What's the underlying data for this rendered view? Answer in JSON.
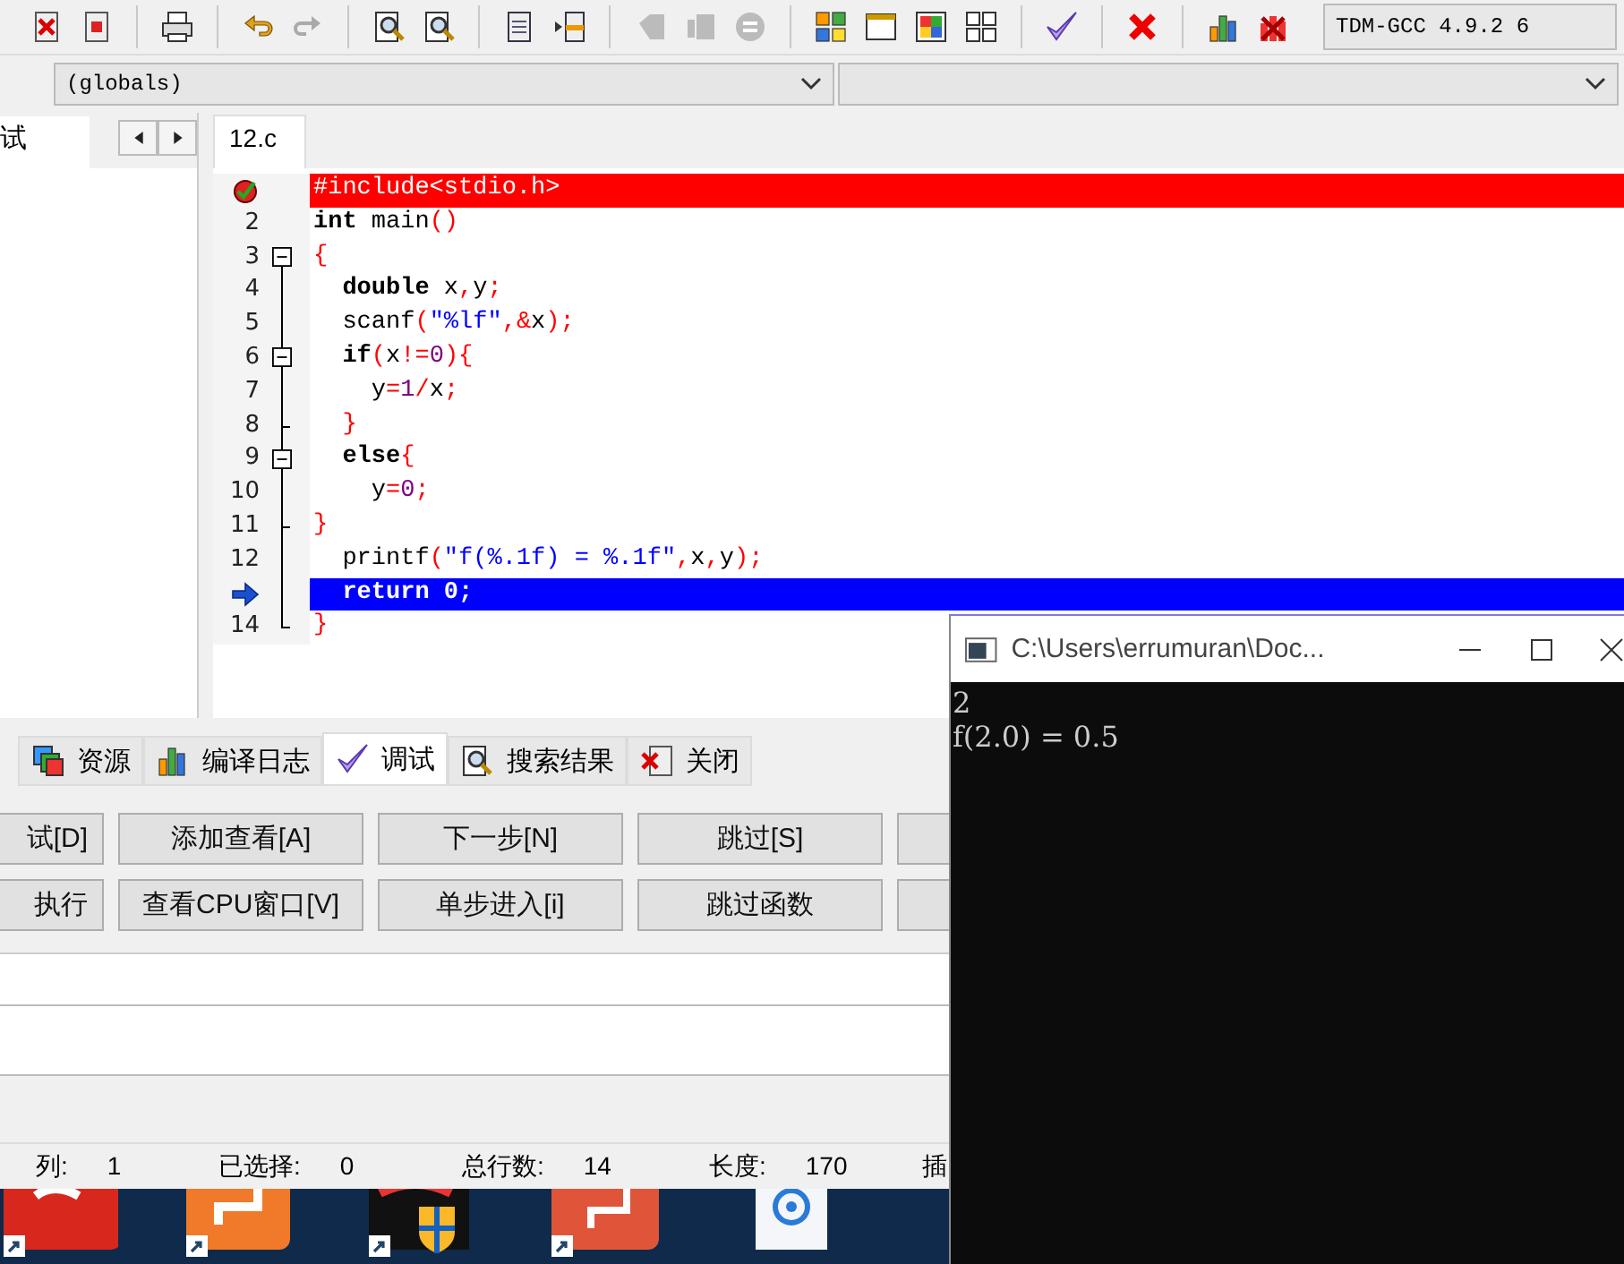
{
  "toolbar": {
    "compiler": "TDM-GCC 4.9.2 6"
  },
  "scope_bar": {
    "scope": "(globals)"
  },
  "left_panel": {
    "tabs": [
      {
        "label": "试",
        "selected": true
      }
    ]
  },
  "editor": {
    "tabs": [
      {
        "label": "12.c",
        "selected": true
      }
    ],
    "lines": [
      {
        "breakpoint": true,
        "current": false,
        "collapsible": false,
        "block_end": false,
        "tokens": [
          {
            "kind": "pre",
            "text": "#include<stdio.h>"
          }
        ]
      },
      {
        "number": "2",
        "breakpoint": false,
        "current": false,
        "collapsible": false,
        "block_end": false,
        "tokens": [
          {
            "kind": "kw",
            "text": "int"
          },
          {
            "kind": "id",
            "text": " main"
          },
          {
            "kind": "sym",
            "text": "()"
          }
        ]
      },
      {
        "number": "3",
        "breakpoint": false,
        "current": false,
        "collapsible": true,
        "block_end": false,
        "tokens": [
          {
            "kind": "sym",
            "text": "{"
          }
        ]
      },
      {
        "number": "4",
        "breakpoint": false,
        "current": false,
        "collapsible": false,
        "block_end": false,
        "tokens": [
          {
            "kind": "kw",
            "text": "  double"
          },
          {
            "kind": "id",
            "text": " x"
          },
          {
            "kind": "sym",
            "text": ","
          },
          {
            "kind": "id",
            "text": "y"
          },
          {
            "kind": "sym",
            "text": ";"
          }
        ]
      },
      {
        "number": "5",
        "breakpoint": false,
        "current": false,
        "collapsible": false,
        "block_end": false,
        "tokens": [
          {
            "kind": "id",
            "text": "  scanf"
          },
          {
            "kind": "sym",
            "text": "("
          },
          {
            "kind": "str",
            "text": "\"%lf\""
          },
          {
            "kind": "sym",
            "text": ",&"
          },
          {
            "kind": "id",
            "text": "x"
          },
          {
            "kind": "sym",
            "text": ");"
          }
        ]
      },
      {
        "number": "6",
        "breakpoint": false,
        "current": false,
        "collapsible": true,
        "block_end": false,
        "tokens": [
          {
            "kind": "kw",
            "text": "  if"
          },
          {
            "kind": "sym",
            "text": "("
          },
          {
            "kind": "id",
            "text": "x"
          },
          {
            "kind": "sym",
            "text": "!="
          },
          {
            "kind": "num",
            "text": "0"
          },
          {
            "kind": "sym",
            "text": "){"
          }
        ]
      },
      {
        "number": "7",
        "breakpoint": false,
        "current": false,
        "collapsible": false,
        "block_end": false,
        "tokens": [
          {
            "kind": "id",
            "text": "    y"
          },
          {
            "kind": "sym",
            "text": "="
          },
          {
            "kind": "num",
            "text": "1"
          },
          {
            "kind": "sym",
            "text": "/"
          },
          {
            "kind": "id",
            "text": "x"
          },
          {
            "kind": "sym",
            "text": ";"
          }
        ]
      },
      {
        "number": "8",
        "breakpoint": false,
        "current": false,
        "collapsible": false,
        "block_end": true,
        "tokens": [
          {
            "kind": "sym",
            "text": "  }"
          }
        ]
      },
      {
        "number": "9",
        "breakpoint": false,
        "current": false,
        "collapsible": true,
        "block_end": false,
        "tokens": [
          {
            "kind": "kw",
            "text": "  else"
          },
          {
            "kind": "sym",
            "text": "{"
          }
        ]
      },
      {
        "number": "10",
        "breakpoint": false,
        "current": false,
        "collapsible": false,
        "block_end": false,
        "tokens": [
          {
            "kind": "id",
            "text": "    y"
          },
          {
            "kind": "sym",
            "text": "="
          },
          {
            "kind": "num",
            "text": "0"
          },
          {
            "kind": "sym",
            "text": ";"
          }
        ]
      },
      {
        "number": "11",
        "breakpoint": false,
        "current": false,
        "collapsible": false,
        "block_end": true,
        "tokens": [
          {
            "kind": "sym",
            "text": "}"
          }
        ]
      },
      {
        "number": "12",
        "breakpoint": false,
        "current": false,
        "collapsible": false,
        "block_end": false,
        "tokens": [
          {
            "kind": "id",
            "text": "  printf"
          },
          {
            "kind": "sym",
            "text": "("
          },
          {
            "kind": "str",
            "text": "\"f(%.1f) = %.1f\""
          },
          {
            "kind": "sym",
            "text": ","
          },
          {
            "kind": "id",
            "text": "x"
          },
          {
            "kind": "sym",
            "text": ","
          },
          {
            "kind": "id",
            "text": "y"
          },
          {
            "kind": "sym",
            "text": ");"
          }
        ]
      },
      {
        "breakpoint": false,
        "current": true,
        "collapsible": false,
        "block_end": false,
        "tokens": [
          {
            "kind": "kw",
            "text": "  return"
          },
          {
            "kind": "num",
            "text": " 0"
          },
          {
            "kind": "sym",
            "text": ";"
          }
        ]
      },
      {
        "number": "14",
        "breakpoint": false,
        "current": false,
        "collapsible": false,
        "block_end": true,
        "tokens": [
          {
            "kind": "sym",
            "text": "}"
          }
        ]
      }
    ]
  },
  "bottom_panel": {
    "tabs": [
      {
        "label": "资源",
        "selected": false
      },
      {
        "label": "编译日志",
        "selected": false
      },
      {
        "label": "调试",
        "selected": true
      },
      {
        "label": "搜索结果",
        "selected": false
      },
      {
        "label": "关闭",
        "selected": false
      }
    ],
    "buttons": [
      [
        "试[D]",
        "添加查看[A]",
        "下一步[N]",
        "跳过[S]"
      ],
      [
        "执行",
        "查看CPU窗口[V]",
        "单步进入[i]",
        "跳过函数"
      ]
    ]
  },
  "status_bar": {
    "fields": [
      {
        "label": "列:",
        "value": "1"
      },
      {
        "label": "已选择:",
        "value": "0"
      },
      {
        "label": "总行数:",
        "value": "14"
      },
      {
        "label": "长度:",
        "value": "170"
      },
      {
        "label": "插"
      }
    ]
  },
  "console": {
    "title": "C:\\Users\\errumuran\\Doc...",
    "lines": [
      "2",
      "f(2.0) = 0.5"
    ]
  }
}
